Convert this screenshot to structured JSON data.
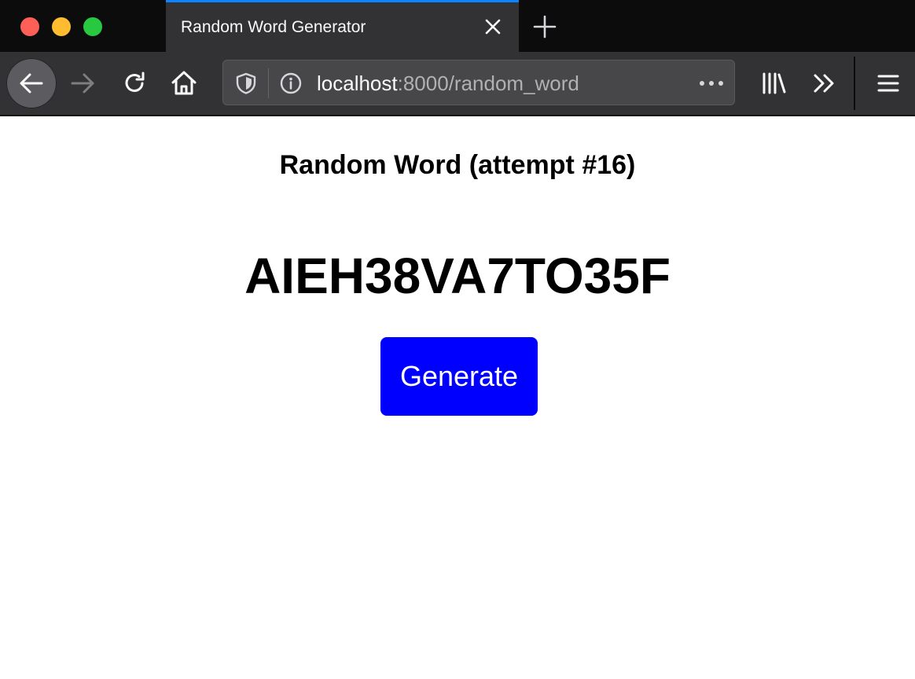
{
  "browser": {
    "tab": {
      "title": "Random Word Generator"
    },
    "address_bar": {
      "host": "localhost",
      "path": ":8000/random_word"
    },
    "icons": {
      "close": "close-icon",
      "decorative_traffic": [
        "close-window",
        "minimize-window",
        "zoom-window"
      ],
      "new_tab": "plus-icon",
      "back": "arrow-left-icon",
      "forward": "arrow-right-icon",
      "reload": "reload-icon",
      "home": "home-icon",
      "tracking_protection": "shield-icon",
      "site_info": "info-icon",
      "page_actions": "ellipsis-icon",
      "library": "library-icon",
      "overflow": "double-chevron-icon",
      "menu": "hamburger-icon"
    }
  },
  "page": {
    "heading": "Random Word (attempt #16)",
    "word": "AIEH38VA7TO35F",
    "generate_label": "Generate"
  },
  "colors": {
    "accent_tab": "#0a84ff",
    "button_bg": "#0000ff",
    "button_text": "#ffffff",
    "toolbar_bg": "#323234",
    "tabbar_bg": "#0c0c0d"
  }
}
